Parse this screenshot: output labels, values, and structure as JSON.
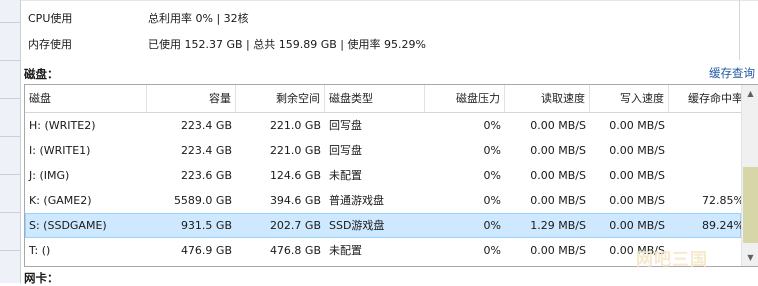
{
  "system": {
    "cpu": {
      "label": "CPU使用",
      "value": "总利用率 0% | 32核"
    },
    "memory": {
      "label": "内存使用",
      "value": "已使用 152.37 GB | 总共 159.89 GB | 使用率 95.29%"
    }
  },
  "disk_section": {
    "title": "磁盘：",
    "cache_query_link": "缓存查询",
    "columns": [
      "磁盘",
      "容量",
      "剩余空间",
      "磁盘类型",
      "磁盘压力",
      "读取速度",
      "写入速度",
      "缓存命中率"
    ],
    "rows": [
      {
        "name": "H: (WRITE2)",
        "capacity": "223.4  GB",
        "free": "221.0  GB",
        "type": "回写盘",
        "pressure": "0%",
        "read": "0.00  MB/S",
        "write": "0.00  MB/S",
        "hit": "",
        "selected": false
      },
      {
        "name": "I: (WRITE1)",
        "capacity": "223.4  GB",
        "free": "221.0  GB",
        "type": "回写盘",
        "pressure": "0%",
        "read": "0.00  MB/S",
        "write": "0.00  MB/S",
        "hit": "",
        "selected": false
      },
      {
        "name": "J: (IMG)",
        "capacity": "223.6  GB",
        "free": "124.6  GB",
        "type": "未配置",
        "pressure": "0%",
        "read": "0.00  MB/S",
        "write": "0.00  MB/S",
        "hit": "",
        "selected": false
      },
      {
        "name": "K: (GAME2)",
        "capacity": "5589.0  GB",
        "free": "394.6  GB",
        "type": "普通游戏盘",
        "pressure": "0%",
        "read": "0.00  MB/S",
        "write": "0.00  MB/S",
        "hit": "72.85%",
        "selected": false
      },
      {
        "name": "S: (SSDGAME)",
        "capacity": "931.5  GB",
        "free": "202.7  GB",
        "type": "SSD游戏盘",
        "pressure": "0%",
        "read": "1.29  MB/S",
        "write": "0.00  MB/S",
        "hit": "89.24%",
        "selected": true
      },
      {
        "name": "T: ()",
        "capacity": "476.9  GB",
        "free": "476.8  GB",
        "type": "未配置",
        "pressure": "0%",
        "read": "0.00  MB/S",
        "write": "0.00  MB/S",
        "hit": "",
        "selected": false
      }
    ],
    "scrollbar": {
      "up_icon": "▲",
      "down_icon": "▼"
    }
  },
  "nic_section": {
    "title": "网卡："
  },
  "watermark": "网吧三国"
}
